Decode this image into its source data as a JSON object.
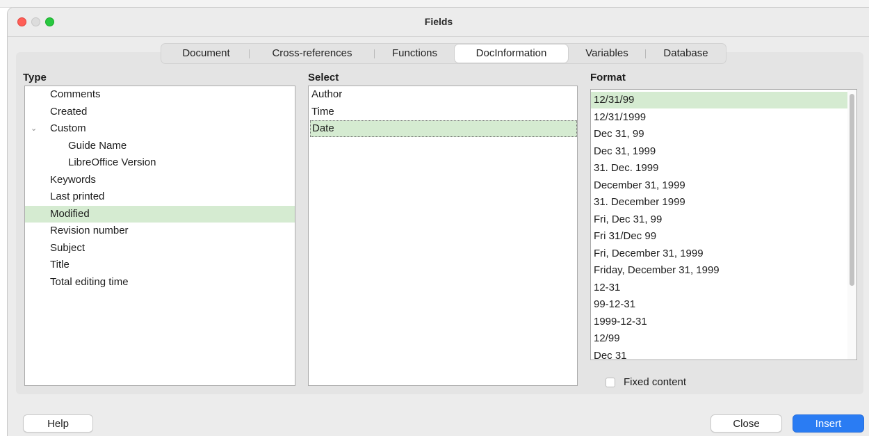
{
  "window": {
    "title": "Fields"
  },
  "tabs": [
    {
      "label": "Document"
    },
    {
      "label": "Cross-references"
    },
    {
      "label": "Functions"
    },
    {
      "label": "DocInformation"
    },
    {
      "label": "Variables"
    },
    {
      "label": "Database"
    }
  ],
  "active_tab": "DocInformation",
  "type": {
    "label": "Type",
    "items": [
      {
        "label": "Comments"
      },
      {
        "label": "Created"
      },
      {
        "label": "Custom"
      },
      {
        "label": "Guide Name"
      },
      {
        "label": "LibreOffice Version"
      },
      {
        "label": "Keywords"
      },
      {
        "label": "Last printed"
      },
      {
        "label": "Modified"
      },
      {
        "label": "Revision number"
      },
      {
        "label": "Subject"
      },
      {
        "label": "Title"
      },
      {
        "label": "Total editing time"
      }
    ],
    "expanded_icon": "chevron-down-icon",
    "selected": "Modified"
  },
  "select": {
    "label": "Select",
    "items": [
      {
        "label": "Author"
      },
      {
        "label": "Time"
      },
      {
        "label": "Date"
      }
    ],
    "selected": "Date"
  },
  "format": {
    "label": "Format",
    "items": [
      {
        "label": "12/31/99"
      },
      {
        "label": "12/31/1999"
      },
      {
        "label": "Dec 31, 99"
      },
      {
        "label": "Dec 31, 1999"
      },
      {
        "label": "31. Dec. 1999"
      },
      {
        "label": "December 31, 1999"
      },
      {
        "label": "31. December 1999"
      },
      {
        "label": "Fri, Dec 31, 99"
      },
      {
        "label": "Fri 31/Dec 99"
      },
      {
        "label": "Fri, December 31, 1999"
      },
      {
        "label": "Friday, December 31, 1999"
      },
      {
        "label": "12-31"
      },
      {
        "label": "99-12-31"
      },
      {
        "label": "1999-12-31"
      },
      {
        "label": "12/99"
      },
      {
        "label": "Dec 31"
      }
    ],
    "selected": "12/31/99"
  },
  "fixed_content": {
    "label": "Fixed content",
    "checked": false
  },
  "buttons": {
    "help": "Help",
    "close": "Close",
    "insert": "Insert"
  },
  "colors": {
    "selection": "#d5ebd1",
    "primary": "#2a7cf3"
  }
}
